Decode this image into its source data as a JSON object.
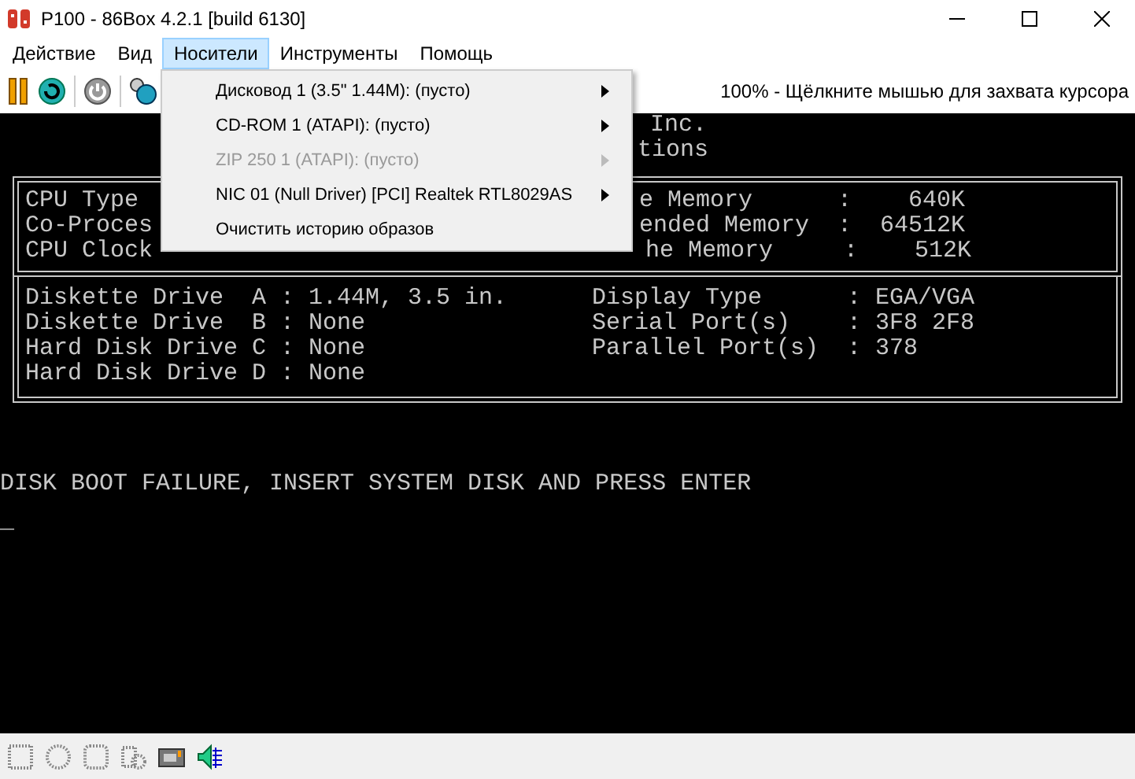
{
  "window": {
    "title": "P100 - 86Box 4.2.1 [build 6130]"
  },
  "menu_bar": [
    {
      "label": "Действие",
      "selected": false
    },
    {
      "label": "Вид",
      "selected": false
    },
    {
      "label": "Носители",
      "selected": true
    },
    {
      "label": "Инструменты",
      "selected": false
    },
    {
      "label": "Помощь",
      "selected": false
    }
  ],
  "toolbar": {
    "status_text": "100% - Щёлкните мышью для захвата курсора"
  },
  "dropdown": {
    "items": [
      {
        "label": "Дисковод 1 (3.5\" 1.44M): (пусто)",
        "disabled": false,
        "submenu": true
      },
      {
        "label": "CD-ROM 1 (ATAPI): (пусто)",
        "disabled": false,
        "submenu": true
      },
      {
        "label": "ZIP 250 1 (ATAPI): (пусто)",
        "disabled": true,
        "submenu": true
      },
      {
        "label": "NIC 01 (Null Driver) [PCI] Realtek RTL8029AS",
        "disabled": false,
        "submenu": true
      },
      {
        "label": "Очистить историю образов",
        "disabled": false,
        "submenu": false
      }
    ]
  },
  "screen": {
    "header_lines": [
      {
        "text": "Inc."
      },
      {
        "text": "tions"
      }
    ],
    "system_box": [
      {
        "left": "CPU Type",
        "right": "e Memory      :    640K"
      },
      {
        "left": "Co-Proces",
        "right": "ended Memory  :  64512K"
      },
      {
        "left": "CPU Clock",
        "right": "he Memory     :    512K"
      }
    ],
    "devices_box": [
      {
        "left": "Diskette Drive  A : 1.44M, 3.5 in.",
        "right": "Display Type      : EGA/VGA"
      },
      {
        "left": "Diskette Drive  B : None",
        "right": "Serial Port(s)    : 3F8 2F8"
      },
      {
        "left": "Hard Disk Drive C : None",
        "right": "Parallel Port(s)  : 378"
      },
      {
        "left": "Hard Disk Drive D : None"
      }
    ],
    "message": "DISK BOOT FAILURE, INSERT SYSTEM DISK AND PRESS ENTER",
    "cursor": "_"
  }
}
